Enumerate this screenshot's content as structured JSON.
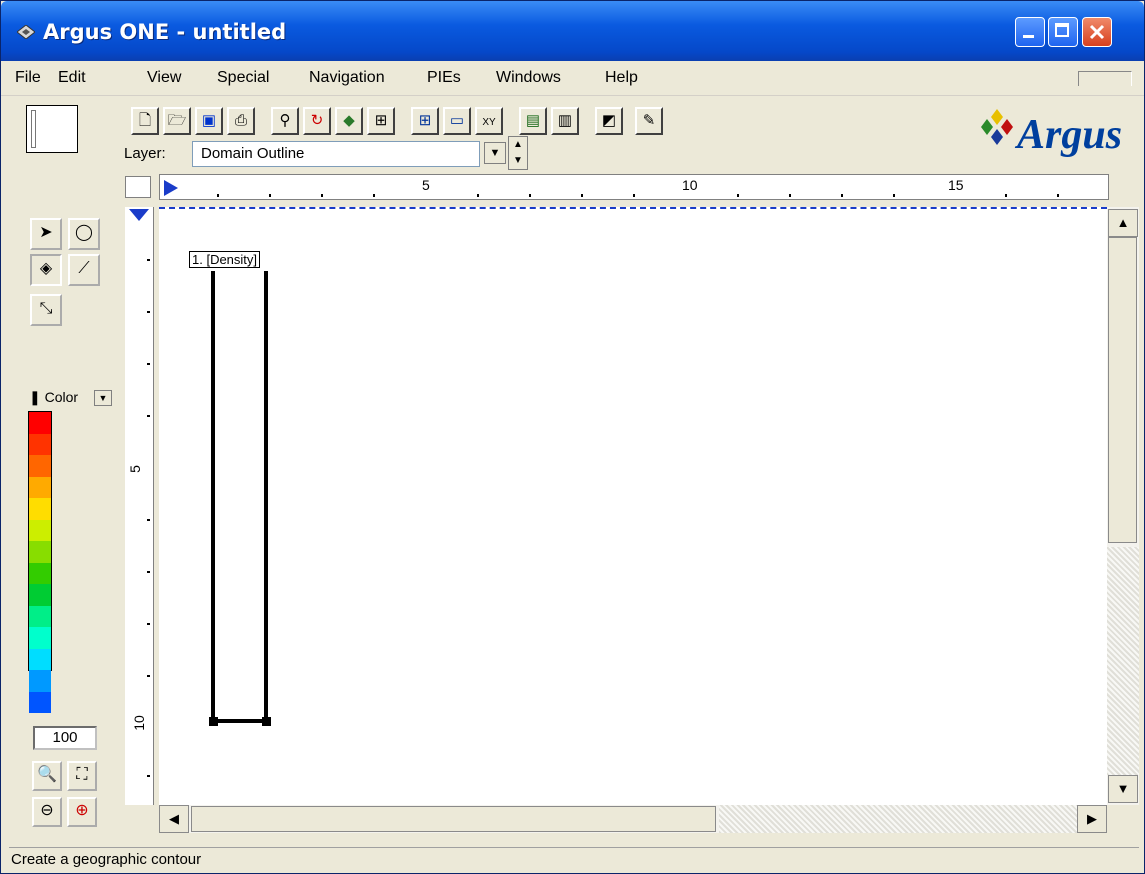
{
  "window": {
    "title": "Argus ONE - untitled"
  },
  "menu": [
    "File",
    "Edit",
    "View",
    "Special",
    "Navigation",
    "PIEs",
    "Windows",
    "Help"
  ],
  "toolbar": {
    "layer_label": "Layer:",
    "layer_value": "Domain Outline",
    "icons": [
      "new-file-icon",
      "open-folder-icon",
      "save-icon",
      "print-icon",
      "find-icon",
      "recalc-icon",
      "pie-icon",
      "fit-icon",
      "grid-icon",
      "ruler-icon",
      "coordinate-icon",
      "book-icon",
      "document-icon",
      "tag-icon",
      "plugin-icon"
    ]
  },
  "logo": {
    "text": "Argus"
  },
  "ruler": {
    "h_labels": [
      "5",
      "10",
      "15"
    ],
    "v_labels": [
      "5",
      "10"
    ]
  },
  "canvas": {
    "contour_label": "1. [Density]"
  },
  "left_panel": {
    "color_label": "Color",
    "colors": [
      "#ff0000",
      "#ff3300",
      "#ff6600",
      "#ffaa00",
      "#ffdd00",
      "#ccee00",
      "#88dd00",
      "#33cc00",
      "#00cc33",
      "#00ee88",
      "#00ffcc",
      "#00ddff",
      "#0099ff",
      "#0055ff"
    ],
    "zoom": "100"
  },
  "status": "Create a geographic contour"
}
